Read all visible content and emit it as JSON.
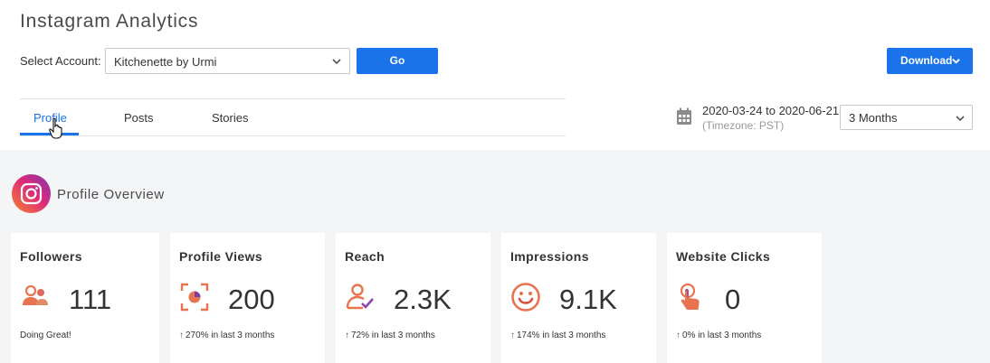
{
  "header": {
    "title": "Instagram Analytics",
    "account_label": "Select Account:",
    "account_value": "Kitchenette by Urmi",
    "go_label": "Go",
    "download_label": "Download"
  },
  "tabs": [
    {
      "label": "Profile",
      "active": true
    },
    {
      "label": "Posts",
      "active": false
    },
    {
      "label": "Stories",
      "active": false
    }
  ],
  "date": {
    "range": "2020-03-24 to 2020-06-21",
    "timezone": "(Timezone: PST)",
    "period": "3 Months"
  },
  "overview": {
    "title": "Profile Overview"
  },
  "cards": [
    {
      "title": "Followers",
      "value": "111",
      "foot": "Doing Great!",
      "icon": "followers-icon"
    },
    {
      "title": "Profile Views",
      "value": "200",
      "foot": "270% in last 3 months",
      "icon": "profile-views-icon"
    },
    {
      "title": "Reach",
      "value": "2.3K",
      "foot": "72% in last 3 months",
      "icon": "reach-icon"
    },
    {
      "title": "Impressions",
      "value": "9.1K",
      "foot": "174% in last 3 months",
      "icon": "impressions-icon"
    },
    {
      "title": "Website Clicks",
      "value": "0",
      "foot": "0% in last 3 months",
      "icon": "website-clicks-icon"
    }
  ],
  "colors": {
    "accent": "#1a73e8",
    "icon_orange": "#e8744f",
    "content_bg": "#f4f5f7"
  }
}
